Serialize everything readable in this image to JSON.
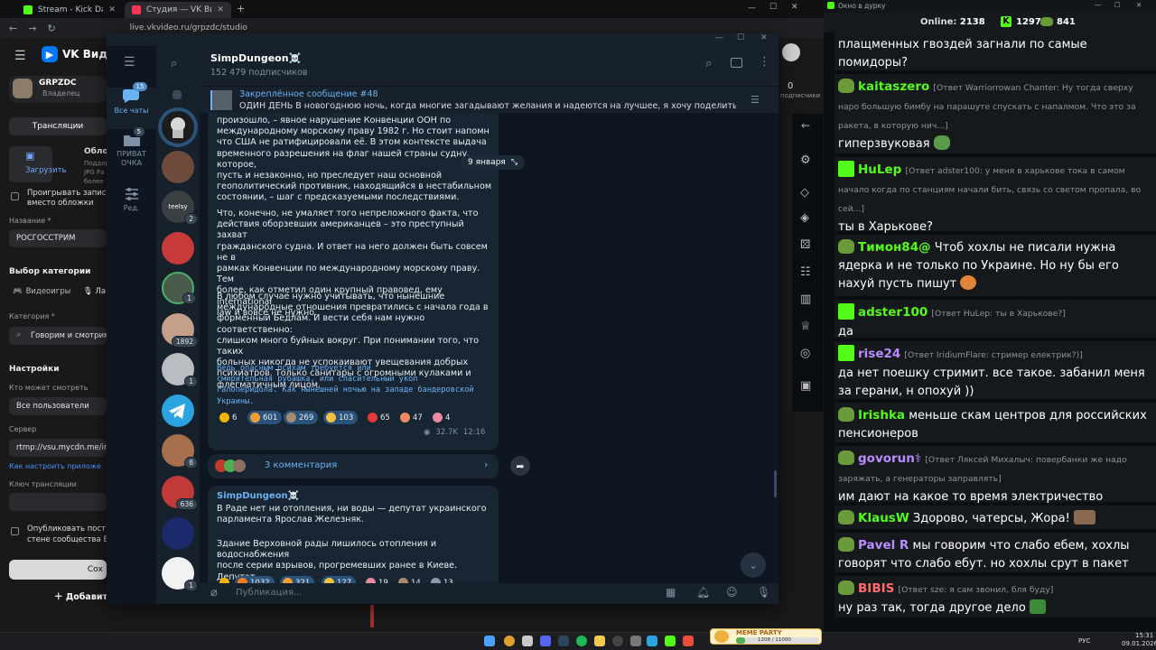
{
  "browser": {
    "tabs": [
      {
        "title": "Stream - Kick Dashboard",
        "icon": "kick-icon"
      },
      {
        "title": "Студия — VK Видео Live",
        "icon": "vk-icon"
      }
    ],
    "new_tab": "+",
    "url": "live.vkvideo.ru/grpzdc/studio",
    "window_controls": {
      "minimize": "—",
      "maximize": "☐",
      "close": "✕"
    }
  },
  "vk_studio": {
    "logo": "VK Видео",
    "channel_name": "GRPZDC",
    "channel_role": "Владелец",
    "tab_broadcasts": "Трансляции",
    "cover_heading": "Облож",
    "cover_help": "Поддер\nJPG Ра\nболее",
    "upload_label": "Загрузить",
    "checkbox_play_label": "Проигрывать запись п\nвместо обложки",
    "name_label": "Название *",
    "name_value": "РОСГОССТРИМ",
    "category_choice_heading": "Выбор категории",
    "tab_games": "Видеоигры",
    "tab_life": "Ла",
    "category_label": "Категория *",
    "category_value": "Говорим и смотрим",
    "settings_heading": "Настройки",
    "who_can_watch_label": "Кто может смотреть",
    "who_can_watch_value": "Все пользователи",
    "server_label": "Сервер",
    "server_value": "rtmp://vsu.mycdn.me/input",
    "setup_link": "Как настроить приложе",
    "stream_key_label": "Ключ трансляции",
    "publish_label": "Опубликовать пост\nстене сообщества В",
    "save_button": "Сох",
    "add_button": "Добавить",
    "right_stat": "0",
    "right_stat_label": "подписчики"
  },
  "telegram": {
    "folders": [
      {
        "label": "Все чаты",
        "badge": "15",
        "icon": "chats-icon"
      },
      {
        "label": "ПРИВАТ ОЧКА",
        "badge": "5",
        "icon": "folder-icon"
      },
      {
        "label": "Ред.",
        "badge": "",
        "icon": "edit-icon"
      }
    ],
    "chat_badges": [
      "",
      "",
      "2",
      "",
      "1",
      "1892",
      "1",
      "",
      "8",
      "636",
      "",
      "1"
    ],
    "channel_name": "SimpDungeon☠️",
    "subscribers": "152 479 подписчиков",
    "pinned_title": "Закреплённое сообщение #48",
    "pinned_text": "ОДИН ДЕНЬ  В новогоднюю ночь, когда многие загадывают желания и надеются на лучшее, я хочу поделиться с в...",
    "date_chip": "9 января",
    "post1": {
      "para1": "произошло, – явное нарушение Конвенции ООН по\nмеждународному морскому праву 1982 г. Но стоит напомн\nчто США не ратифицировали её. В этом контексте выдача\nвременного разрешения на флаг нашей страны судну, которое,\nпусть и незаконно, но преследует наш основной\nгеополитический противник, находящийся в нестабильном\nсостоянии, – шаг с предсказуемыми последствиями.",
      "para2": "Что, конечно, не умаляет того непреложного факта, что\nдействия оборзевших американцев – это преступный захват\nгражданского судна. И ответ на него должен быть совсем не в\nрамках Конвенции по международному морскому праву. Тем\nболее, как отметил один крупный правовед, ему international\nlaw и вовсе не нужно.",
      "para3": "В любом случае нужно учитывать, что нынешние\nмеждународные отношения превратились с начала года в\nформенный Бедлам. И вести себя нам нужно соответственно:\nслишком много буйных вокруг. При понимании того, что таких\nбольных никогда не успокаивают увещевания добрых\nпсихиатров. Только санитары с огромными кулаками и\nфлегматичным лицом.",
      "link_text": "Ведь опасным психам требуется или\nсмирительная рубашка, или спасительный укол\nгалоперидола. Как нынешней ночью на западе бандеровской\nУкраины.",
      "reactions": [
        {
          "emoji": "star",
          "count": "6",
          "color": "#f5b301"
        },
        {
          "emoji": "laugh",
          "count": "601",
          "color": "#f0a030"
        },
        {
          "emoji": "cat",
          "count": "269",
          "color": "#a98a70"
        },
        {
          "emoji": "thumbs-up",
          "count": "103",
          "color": "#f3c13a"
        },
        {
          "emoji": "heart",
          "count": "65",
          "color": "#e53935"
        },
        {
          "emoji": "clown",
          "count": "47",
          "color": "#f08a65"
        },
        {
          "emoji": "pig",
          "count": "4",
          "color": "#e88aa0"
        }
      ],
      "views": "32.7K",
      "time": "12:16",
      "comments": "3 комментария"
    },
    "post2": {
      "author": "SimpDungeon☠️",
      "para1": "В Раде нет ни отопления, ни воды — депутат украинского\nпарламента Ярослав Железняк.",
      "para2": "Здание Верховной рады лишилось отопления и водоснабжения\nпосле серии взрывов, прогремевших ранее в Киеве. Депутат\nдобавил, что свет \"пока есть\".",
      "reactions": [
        {
          "emoji": "star",
          "count": "",
          "color": "#f5b301"
        },
        {
          "emoji": "fire",
          "count": "1032",
          "color": "#ff7a1a"
        },
        {
          "emoji": "laugh",
          "count": "321",
          "color": "#f0a030"
        },
        {
          "emoji": "thumbs-up",
          "count": "127",
          "color": "#f3c13a"
        },
        {
          "emoji": "pig",
          "count": "19",
          "color": "#e88aa0"
        },
        {
          "emoji": "cat",
          "count": "14",
          "color": "#a98a70"
        },
        {
          "emoji": "doc",
          "count": "13",
          "color": "#8a9aab"
        }
      ]
    },
    "composer_placeholder": "Публикация..."
  },
  "chat": {
    "window_title": "Окно в дурку",
    "online_label": "Online:",
    "online_count": "2138",
    "kick_count": "1297",
    "pepe_count": "841",
    "messages": [
      {
        "user": "",
        "color": "#ffffff",
        "badge": "",
        "reply": "",
        "text": "плащменных гвоздей загнали по самые помидоры?"
      },
      {
        "user": "kaitaszero",
        "color": "#53fc18",
        "badge": "pepe",
        "reply": "[Ответ Warriorrowan Chanter: Ну тогда сверху нарo большую бимбу на парашуте спускать с напалмом. Что это за ракета, в которую нич...]",
        "text": "гиперзвуковая"
      },
      {
        "user": "HuLep",
        "color": "#53fc18",
        "badge": "kick",
        "reply": "[Ответ adster100: у меня в харькове тока в самом начало когда по станциям начали бить, связь со светом пропала, во сей...]",
        "text": "ты в Харькове?"
      },
      {
        "user": "Тимон84@",
        "color": "#53fc18",
        "badge": "pepe",
        "reply": "",
        "text": "Чтоб хохлы не писали нужна ядерка и не только по Украине. Но ну бы его нахуй пусть пишут"
      },
      {
        "user": "adster100",
        "color": "#53fc18",
        "badge": "kick",
        "reply": "[Ответ HuLep: ты в Харькове?]",
        "text": "да"
      },
      {
        "user": "rise24",
        "color": "#b98cff",
        "badge": "kick",
        "reply": "[Ответ IridiumFlare: стример електрик?)]",
        "text": "да нет поешку стримит. все такое. забанил меня за герани, н опохуй ))"
      },
      {
        "user": "Irishka",
        "color": "#53fc18",
        "badge": "pepe",
        "reply": "",
        "text": "меньше скам центров для российских пенсионеров"
      },
      {
        "user": "govorun⚕",
        "color": "#b98cff",
        "badge": "pepe",
        "reply": "[Ответ Ляксей Михалыч: повербанки же надо заряжать, а генераторы заправлять]",
        "text": "им дают на какое то время электричество"
      },
      {
        "user": "KlausW",
        "color": "#53fc18",
        "badge": "pepe",
        "reply": "",
        "text": "Здорово, чатерсы, Жора!"
      },
      {
        "user": "Pavel R",
        "color": "#b98cff",
        "badge": "pepe",
        "reply": "",
        "text": "мы говорим что слабо ебем, хохлы говорят что слабо ебут. но хохлы срут в пакет"
      },
      {
        "user": "BIBIS",
        "color": "#ff6b6b",
        "badge": "pepe",
        "reply": "[Ответ sze: я сам звонил, бля буду]",
        "text": "ну раз так, тогда другое дело"
      }
    ]
  },
  "taskbar": {
    "widget_title": "MEME PARTY",
    "widget_progress": "1208 / 11000",
    "lang": "РУС",
    "time": "15:31",
    "date": "09.01.2026"
  },
  "colors": {
    "kick_green": "#53fc18",
    "tg_accent": "#6ab3f3",
    "tg_bubble": "#182533",
    "vk_blue": "#0077ff"
  }
}
